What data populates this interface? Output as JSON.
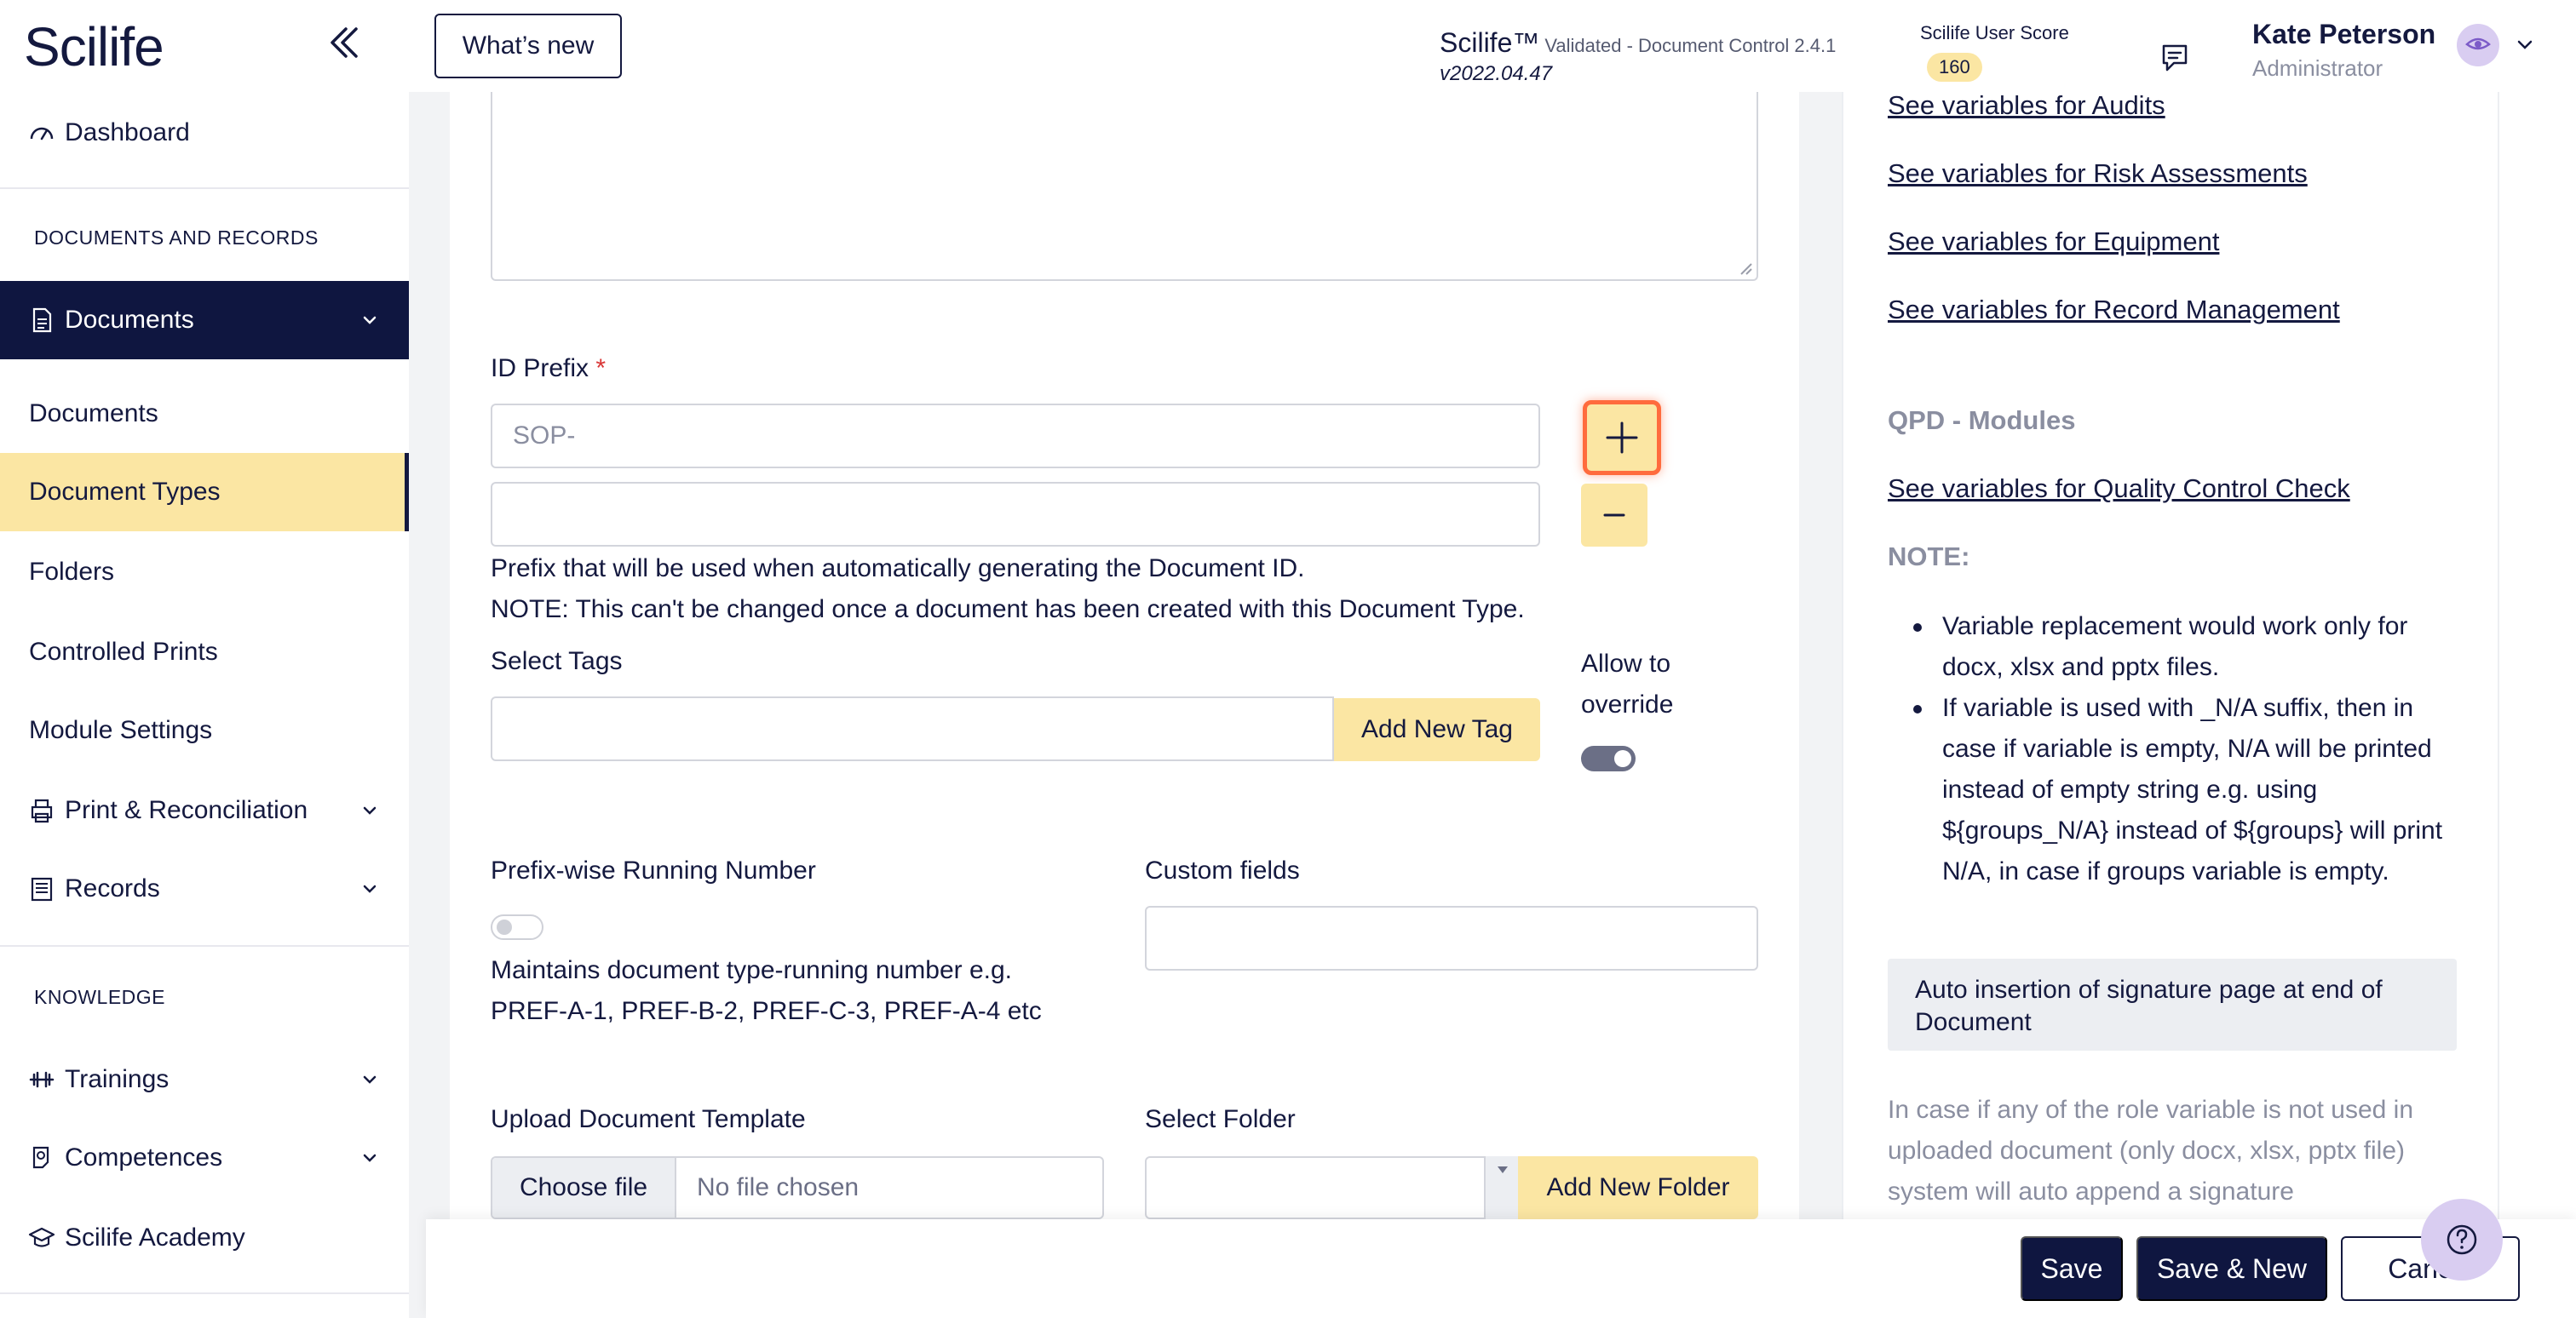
{
  "header": {
    "logo": "Scilife",
    "whats_new": "What’s new",
    "brand": "Scilife™",
    "brand_sub": "Validated - Document Control 2.4.1",
    "version": "v2022.04.47",
    "score_label": "Scilife User Score",
    "score_value": "160",
    "user_name": "Kate Peterson",
    "user_role": "Administrator"
  },
  "sidebar": {
    "dashboard": "Dashboard",
    "section_docs": "DOCUMENTS AND RECORDS",
    "documents_group": "Documents",
    "sub_documents": "Documents",
    "sub_document_types": "Document Types",
    "sub_folders": "Folders",
    "sub_controlled_prints": "Controlled Prints",
    "sub_module_settings": "Module Settings",
    "print_reconciliation": "Print & Reconciliation",
    "records": "Records",
    "section_knowledge": "KNOWLEDGE",
    "trainings": "Trainings",
    "competences": "Competences",
    "scilife_academy": "Scilife Academy"
  },
  "form": {
    "id_prefix_label": "ID Prefix",
    "required_mark": "*",
    "id_prefix_placeholder": "SOP-",
    "prefix_help_1": "Prefix that will be used when automatically generating the Document ID.",
    "prefix_help_2": "NOTE: This can't be changed once a document has been created with this Document Type.",
    "select_tags_label": "Select Tags",
    "add_new_tag": "Add New Tag",
    "allow_override_1": "Allow to",
    "allow_override_2": "override",
    "allow_override_on": true,
    "running_number_label": "Prefix-wise Running Number",
    "running_number_on": false,
    "running_number_help_1": "Maintains document type-running number e.g.",
    "running_number_help_2": "PREF-A-1, PREF-B-2, PREF-C-3, PREF-A-4 etc",
    "custom_fields_label": "Custom fields",
    "upload_template_label": "Upload Document Template",
    "choose_file": "Choose file",
    "no_file": "No file chosen",
    "select_folder_label": "Select Folder",
    "add_new_folder": "Add New Folder"
  },
  "right_panel": {
    "links_top": [
      "See variables for Audits",
      "See variables for Risk Assessments",
      "See variables for Equipment",
      "See variables for Record Management"
    ],
    "qpd_heading": "QPD - Modules",
    "qpd_link": "See variables for Quality Control Check",
    "note_heading": "NOTE:",
    "notes": [
      "Variable replacement would work only for docx, xlsx and pptx files.",
      "If variable is used with _N/A suffix, then in case if variable is empty, N/A will be printed instead of empty string e.g. using ${groups_N/A} instead of ${groups} will print N/A, in case if groups variable is empty."
    ],
    "box_title": "Auto insertion of signature page at end of Document",
    "para": "In case if any of the role variable is not used in uploaded document (only docx, xlsx, pptx file) system will auto append a signature"
  },
  "footer": {
    "save": "Save",
    "save_new": "Save & New",
    "cancel": "Cancel"
  },
  "colors": {
    "navy": "#0f1640",
    "accent_yellow": "#fbe6a3",
    "highlight_orange": "#ff6b3d",
    "lavender": "#d9cdf1"
  }
}
